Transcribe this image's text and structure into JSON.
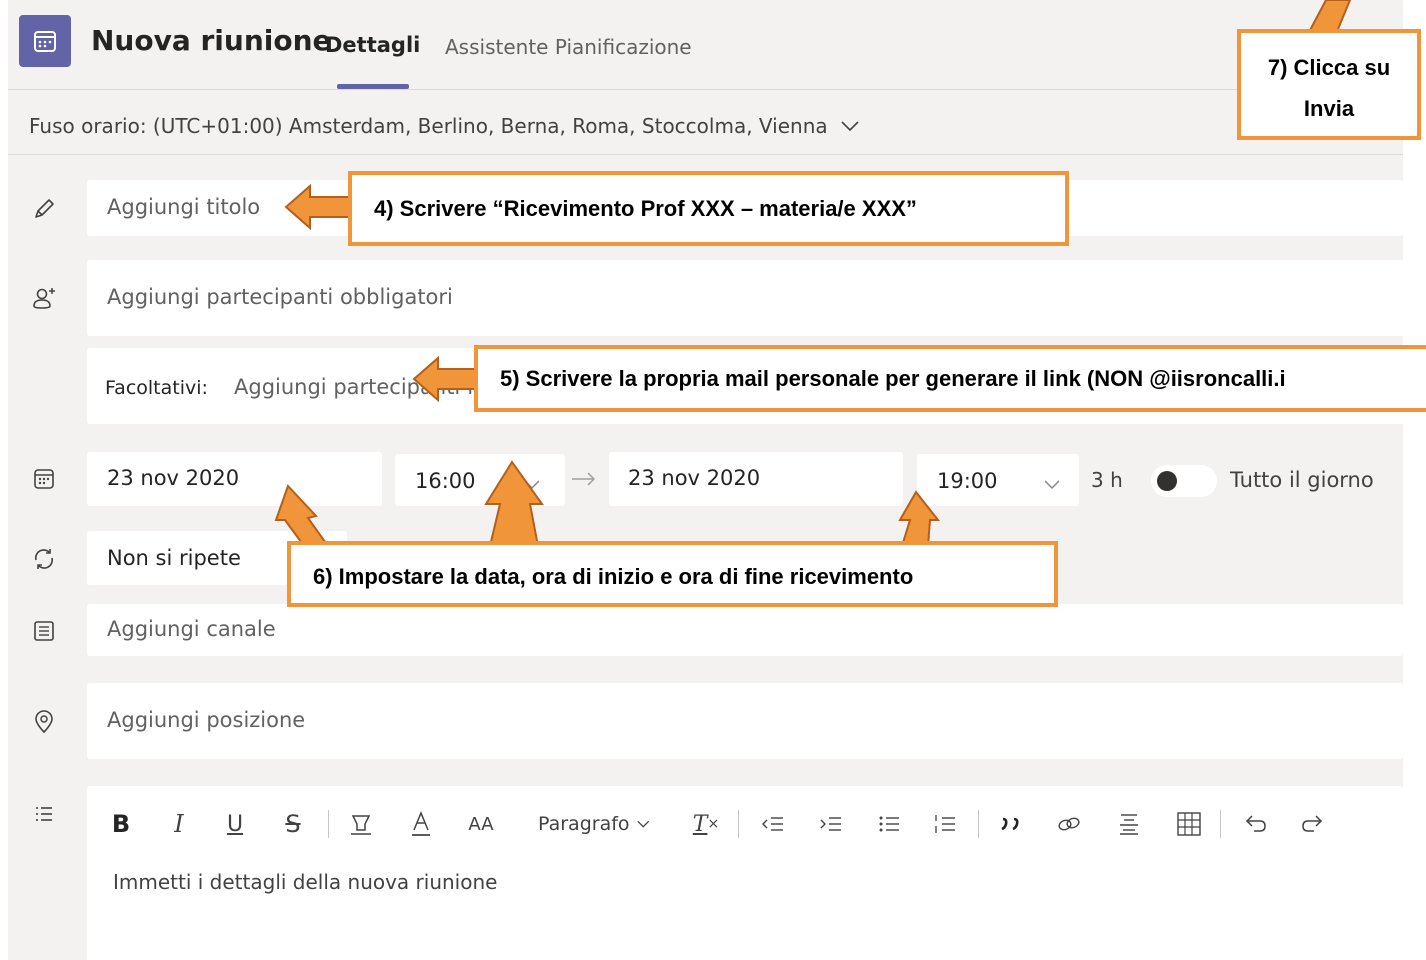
{
  "header": {
    "title": "Nuova riunione",
    "tabs": [
      {
        "label": "Dettagli",
        "active": true
      },
      {
        "label": "Assistente Pianificazione",
        "active": false
      }
    ]
  },
  "timezone": {
    "label": "Fuso orario: (UTC+01:00) Amsterdam, Berlino, Berna, Roma, Stoccolma, Vienna"
  },
  "form": {
    "title_placeholder": "Aggiungi titolo",
    "required_placeholder": "Aggiungi partecipanti obbligatori",
    "optional_label": "Facoltativi:",
    "optional_placeholder": "Aggiungi partecipanti facoltativi",
    "start_date": "23 nov 2020",
    "start_time": "16:00",
    "end_date": "23 nov 2020",
    "end_time": "19:00",
    "duration": "3 h",
    "all_day_label": "Tutto il giorno",
    "repeat": "Non si ripete",
    "channel_placeholder": "Aggiungi canale",
    "location_placeholder": "Aggiungi posizione",
    "details_placeholder": "Immetti i dettagli della nuova riunione"
  },
  "toolbar": {
    "bold": "B",
    "italic": "I",
    "underline": "U",
    "strike": "S",
    "font_size": "AA",
    "paragraph": "Paragrafo",
    "clear": "T"
  },
  "callouts": {
    "step4": "4)   Scrivere “Ricevimento Prof  XXX  – materia/e  XXX”",
    "step5": "5)   Scrivere la propria mail personale per generare il link (NON @iisroncalli.i",
    "step6": "6) Impostare la data, ora di inizio e ora di fine ricevimento",
    "step7_line1": "7) Clicca su",
    "step7_line2": "Invia"
  },
  "colors": {
    "accent": "#6264a7",
    "callout_border": "#f0953a",
    "arrow_fill": "#f0953a",
    "arrow_stroke": "#b45f1c"
  }
}
